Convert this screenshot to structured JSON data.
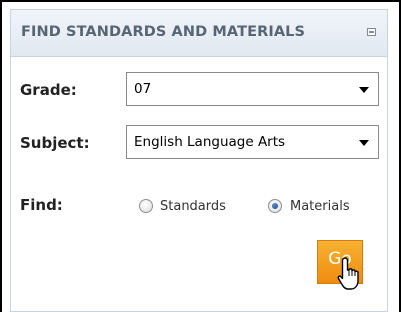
{
  "panel": {
    "title": "FIND STANDARDS AND MATERIALS",
    "collapse_icon": "collapse-icon"
  },
  "form": {
    "grade": {
      "label": "Grade:",
      "value": "07"
    },
    "subject": {
      "label": "Subject:",
      "value": "English Language Arts"
    },
    "find": {
      "label": "Find:",
      "options": [
        {
          "label": "Standards",
          "checked": false
        },
        {
          "label": "Materials",
          "checked": true
        }
      ]
    },
    "go_button": {
      "label": "Go",
      "color": "#f29a1e"
    }
  },
  "cursor": "hand-pointer-icon"
}
